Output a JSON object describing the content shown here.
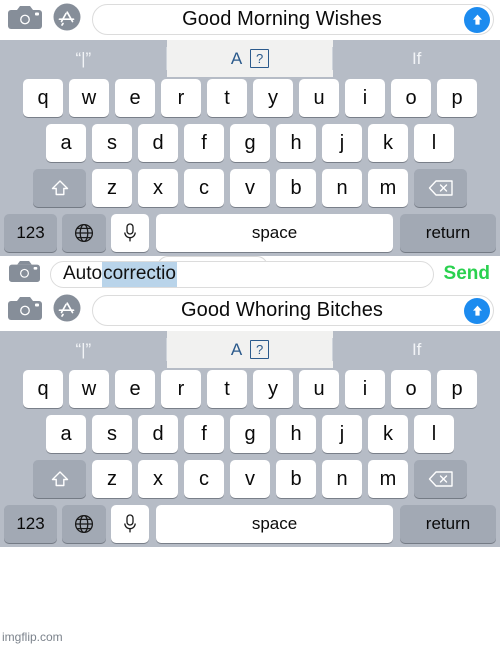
{
  "meme": {
    "watermark": "imgflip.com",
    "colors": {
      "send_blue": "#1c8bef",
      "send_green": "#2ad14f",
      "keyboard_bg": "#b6bcc6",
      "key_white": "#ffffff",
      "key_dark": "#a2a9b4",
      "suggestion_active_text": "#2b5a8c",
      "popup_word": "#3a6ea8",
      "selection_highlight": "#b9d4ea"
    }
  },
  "panel_top": {
    "compose": {
      "camera_icon": "camera-icon",
      "appstore_icon": "app-store-icon",
      "message_text": "Good Morning Wishes",
      "send_icon": "arrow-up-icon"
    },
    "suggestions": [
      {
        "label": "“|”",
        "active": false
      },
      {
        "label": "A",
        "glyph": "?",
        "active": true
      },
      {
        "label": "If",
        "active": false
      }
    ]
  },
  "autocorrect": {
    "popup": {
      "word": "correction",
      "close_icon": "×"
    },
    "camera_icon": "camera-icon",
    "field": {
      "prefix": "Auto ",
      "selected": "correctio"
    },
    "send_label": "Send"
  },
  "panel_bottom": {
    "compose": {
      "camera_icon": "camera-icon",
      "appstore_icon": "app-store-icon",
      "message_text": "Good Whoring Bitches",
      "send_icon": "arrow-up-icon"
    },
    "suggestions": [
      {
        "label": "“|”",
        "active": false
      },
      {
        "label": "A",
        "glyph": "?",
        "active": true
      },
      {
        "label": "If",
        "active": false
      }
    ]
  },
  "keyboard": {
    "row1": [
      "q",
      "w",
      "e",
      "r",
      "t",
      "y",
      "u",
      "i",
      "o",
      "p"
    ],
    "row2": [
      "a",
      "s",
      "d",
      "f",
      "g",
      "h",
      "j",
      "k",
      "l"
    ],
    "row3": [
      "z",
      "x",
      "c",
      "v",
      "b",
      "n",
      "m"
    ],
    "shift_icon": "shift-icon",
    "delete_icon": "backspace-icon",
    "numbers_label": "123",
    "globe_icon": "globe-icon",
    "mic_icon": "microphone-icon",
    "space_label": "space",
    "return_label": "return"
  }
}
